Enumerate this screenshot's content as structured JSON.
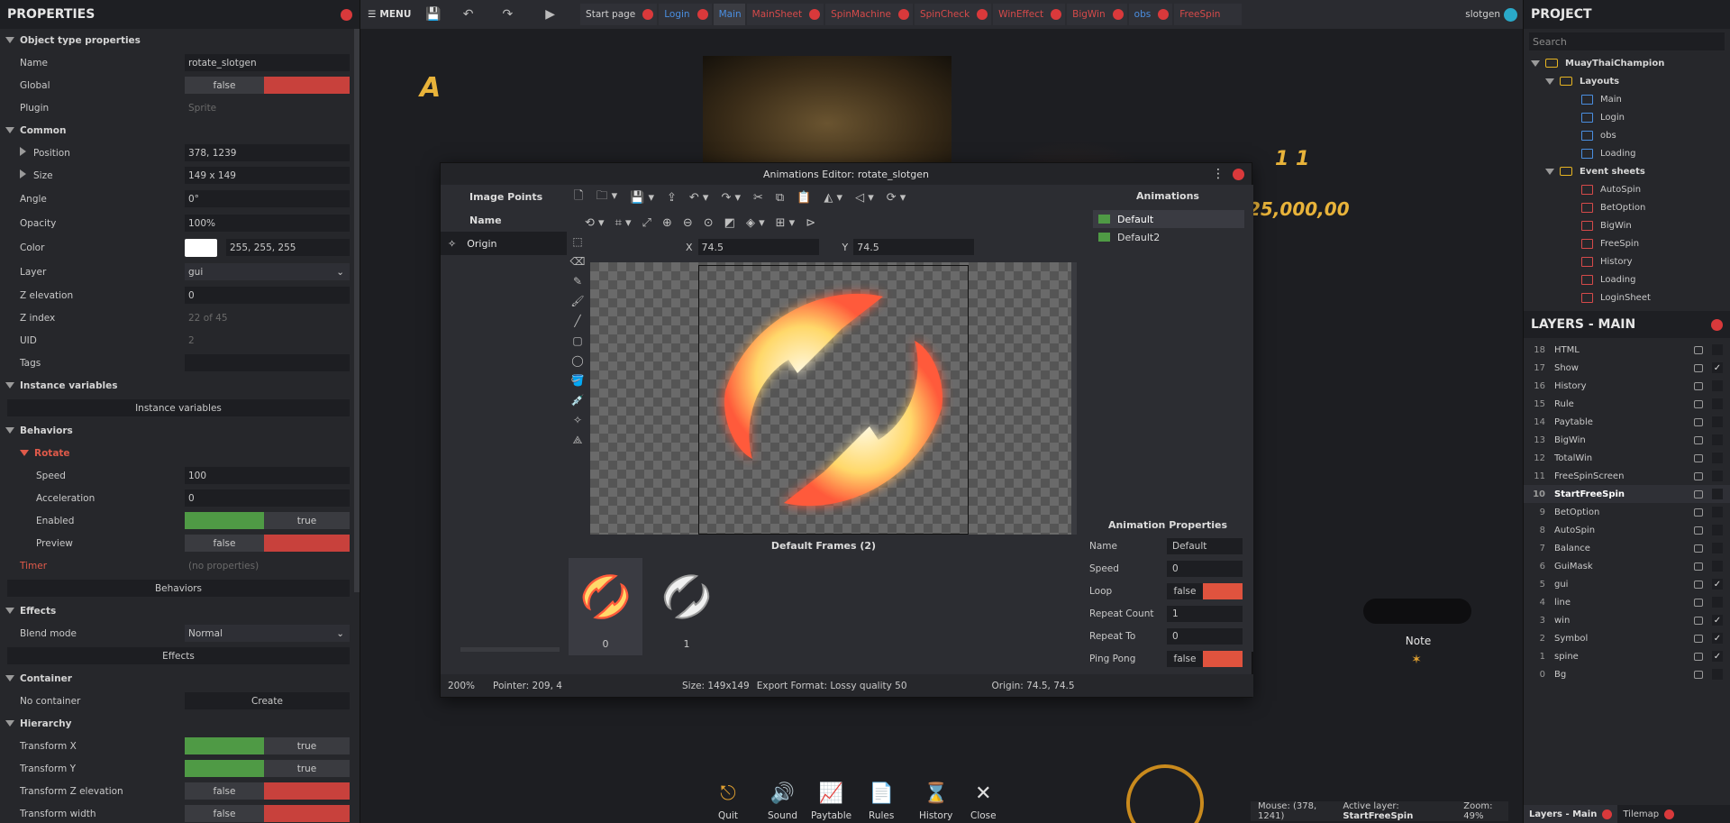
{
  "properties": {
    "title": "PROPERTIES",
    "object_type_header": "Object type properties",
    "name_label": "Name",
    "name_value": "rotate_slotgen",
    "global_label": "Global",
    "global_value": "false",
    "plugin_label": "Plugin",
    "plugin_value": "Sprite",
    "common_header": "Common",
    "position_label": "Position",
    "position_value": "378, 1239",
    "size_label": "Size",
    "size_value": "149 x 149",
    "angle_label": "Angle",
    "angle_value": "0°",
    "opacity_label": "Opacity",
    "opacity_value": "100%",
    "color_label": "Color",
    "color_value": "255, 255, 255",
    "layer_label": "Layer",
    "layer_value": "gui",
    "zelev_label": "Z elevation",
    "zelev_value": "0",
    "zindex_label": "Z index",
    "zindex_value": "22 of 45",
    "uid_label": "UID",
    "uid_value": "2",
    "tags_label": "Tags",
    "tags_value": "",
    "instvars_header": "Instance variables",
    "instvars_button": "Instance variables",
    "behaviors_header": "Behaviors",
    "rotate_header": "Rotate",
    "speed_label": "Speed",
    "speed_value": "100",
    "accel_label": "Acceleration",
    "accel_value": "0",
    "enabled_label": "Enabled",
    "enabled_value": "true",
    "preview_label": "Preview",
    "preview_value": "false",
    "timer_label": "Timer",
    "timer_value": "(no properties)",
    "behaviors_button": "Behaviors",
    "effects_header": "Effects",
    "blend_label": "Blend mode",
    "blend_value": "Normal",
    "effects_button": "Effects",
    "container_header": "Container",
    "nocontainer_label": "No container",
    "create_button": "Create",
    "hierarchy_header": "Hierarchy",
    "tx_label": "Transform X",
    "tx_value": "true",
    "ty_label": "Transform Y",
    "ty_value": "true",
    "tz_label": "Transform Z elevation",
    "tz_value": "false",
    "tw_label": "Transform width",
    "tw_value": "false"
  },
  "topbar": {
    "menu": "MENU",
    "tabs": [
      {
        "label": "Start page"
      },
      {
        "label": "Login"
      },
      {
        "label": "Main"
      },
      {
        "label": "MainSheet"
      },
      {
        "label": "SpinMachine"
      },
      {
        "label": "SpinCheck"
      },
      {
        "label": "WinEffect"
      },
      {
        "label": "BigWin"
      },
      {
        "label": "obs"
      },
      {
        "label": "FreeSpin"
      }
    ],
    "user": "slotgen"
  },
  "project": {
    "title": "PROJECT",
    "search_placeholder": "Search",
    "root": "MuayThaiChampion",
    "layouts_folder": "Layouts",
    "layouts": [
      "Main",
      "Login",
      "obs",
      "Loading"
    ],
    "events_folder": "Event sheets",
    "events": [
      "AutoSpin",
      "BetOption",
      "BigWin",
      "FreeSpin",
      "History",
      "Loading",
      "LoginSheet"
    ]
  },
  "layers": {
    "title": "LAYERS - MAIN",
    "items": [
      {
        "n": "18",
        "name": "HTML",
        "check": ""
      },
      {
        "n": "17",
        "name": "Show",
        "check": "✓"
      },
      {
        "n": "16",
        "name": "History",
        "check": ""
      },
      {
        "n": "15",
        "name": "Rule",
        "check": ""
      },
      {
        "n": "14",
        "name": "Paytable",
        "check": ""
      },
      {
        "n": "13",
        "name": "BigWin",
        "check": ""
      },
      {
        "n": "12",
        "name": "TotalWin",
        "check": ""
      },
      {
        "n": "11",
        "name": "FreeSpinScreen",
        "check": ""
      },
      {
        "n": "10",
        "name": "StartFreeSpin",
        "check": ""
      },
      {
        "n": "9",
        "name": "BetOption",
        "check": ""
      },
      {
        "n": "8",
        "name": "AutoSpin",
        "check": ""
      },
      {
        "n": "7",
        "name": "Balance",
        "check": ""
      },
      {
        "n": "6",
        "name": "GuiMask",
        "check": ""
      },
      {
        "n": "5",
        "name": "gui",
        "check": "✓"
      },
      {
        "n": "4",
        "name": "line",
        "check": ""
      },
      {
        "n": "3",
        "name": "win",
        "check": "✓"
      },
      {
        "n": "2",
        "name": "Symbol",
        "check": "✓"
      },
      {
        "n": "1",
        "name": "spine",
        "check": "✓"
      },
      {
        "n": "0",
        "name": "Bg",
        "check": ""
      }
    ],
    "tab_layers": "Layers - Main",
    "tab_tilemap": "Tilemap"
  },
  "editor": {
    "title": "Animations Editor: rotate_slotgen",
    "image_points": "Image Points",
    "name_col": "Name",
    "origin": "Origin",
    "x_label": "X",
    "x_value": "74.5",
    "y_label": "Y",
    "y_value": "74.5",
    "animations_title": "Animations",
    "animations": [
      "Default",
      "Default2"
    ],
    "frames_title": "Default Frames (2)",
    "frames": [
      "0",
      "1"
    ],
    "anim_props_title": "Animation Properties",
    "ap_name_label": "Name",
    "ap_name_value": "Default",
    "ap_speed_label": "Speed",
    "ap_speed_value": "0",
    "ap_loop_label": "Loop",
    "ap_loop_value": "false",
    "ap_repcount_label": "Repeat Count",
    "ap_repcount_value": "1",
    "ap_repto_label": "Repeat To",
    "ap_repto_value": "0",
    "ap_pingpong_label": "Ping Pong",
    "ap_pingpong_value": "false",
    "status_zoom": "200%",
    "status_pointer": "Pointer: 209, 4",
    "status_size": "Size: 149x149",
    "status_export": "Export Format: Lossy quality 50",
    "status_origin": "Origin: 74.5, 74.5"
  },
  "viewport": {
    "number_text": "1 1",
    "amount_text": "25,000,00",
    "note_label": "Note",
    "buttons": [
      {
        "label": "Quit"
      },
      {
        "label": "Sound"
      },
      {
        "label": "Paytable"
      },
      {
        "label": "Rules"
      },
      {
        "label": "History"
      },
      {
        "label": "Close"
      }
    ],
    "status_mouse": "Mouse: (378, 1241)",
    "status_layer_label": "Active layer:",
    "status_layer": "StartFreeSpin",
    "status_zoom": "Zoom: 49%"
  }
}
